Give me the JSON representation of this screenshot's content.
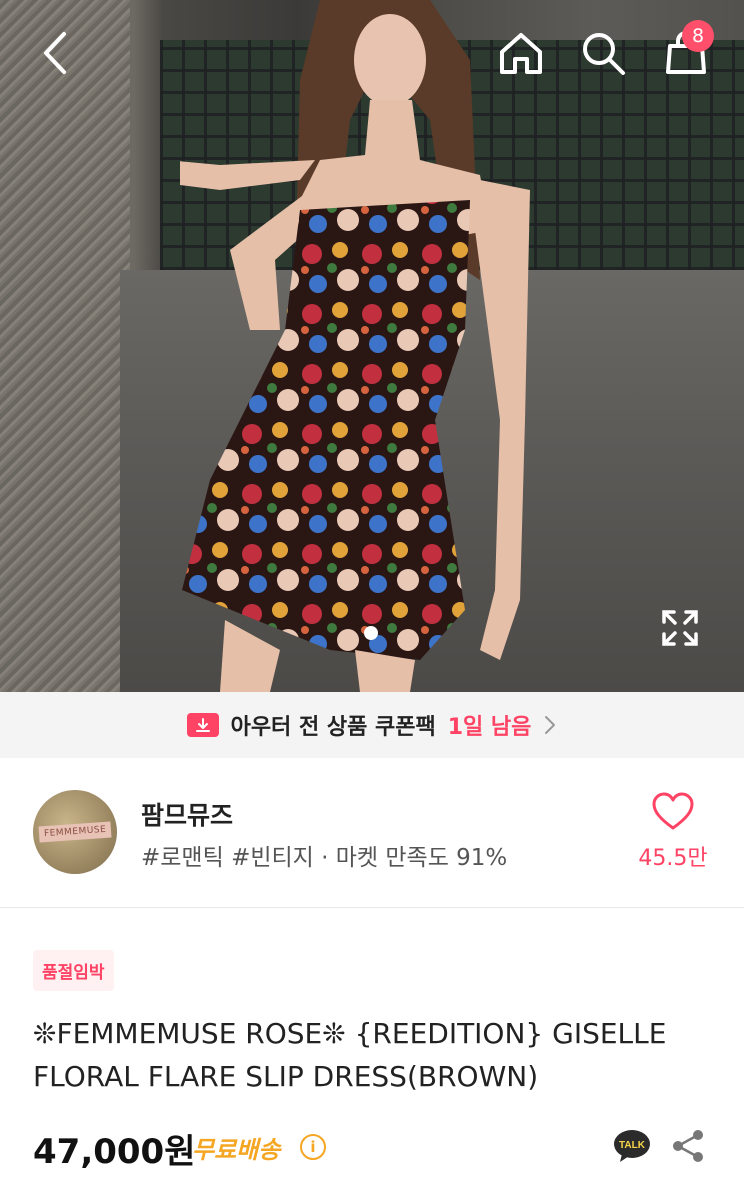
{
  "header": {
    "cart_count": "8"
  },
  "coupon": {
    "text": "아우터 전 상품 쿠폰팩",
    "highlight": "1일 남음"
  },
  "seller": {
    "name": "팜므뮤즈",
    "tags": "#로맨틱 #빈티지 · 마켓 만족도 91%",
    "avatar_text": "FEMMEMUSE",
    "like_count": "45.5만"
  },
  "product": {
    "badge": "품절임박",
    "title": "❊FEMMEMUSE ROSE❊ {REEDITION} GISELLE FLORAL FLARE SLIP DRESS(BROWN)",
    "price": "47,000원",
    "shipping": "무료배송"
  },
  "icons": [
    "back-icon",
    "home-icon",
    "search-icon",
    "cart-icon",
    "expand-icon",
    "coupon-download-icon",
    "chevron-right-icon",
    "heart-icon",
    "info-icon",
    "kakao-talk-icon",
    "share-icon"
  ],
  "colors": {
    "accent": "#ff4365",
    "shipping": "#f5a623"
  }
}
